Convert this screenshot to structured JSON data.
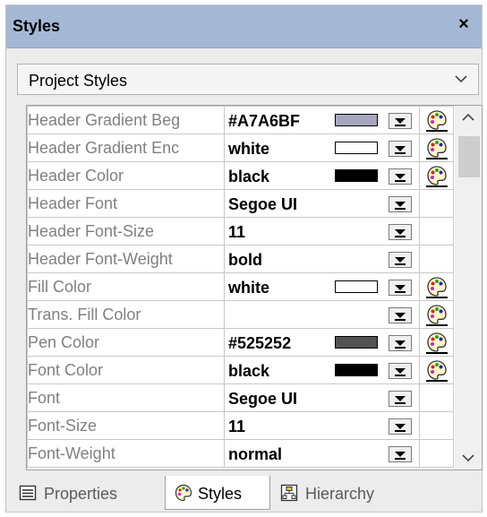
{
  "panel": {
    "title": "Styles",
    "close_label": "×"
  },
  "scope_dropdown": {
    "selected": "Project Styles"
  },
  "rows": [
    {
      "name": "Header Gradient Beg",
      "value": "#A7A6BF",
      "swatch": "#A7A6BF",
      "picker": true
    },
    {
      "name": "Header Gradient Enc",
      "value": "white",
      "swatch": "#ffffff",
      "picker": true
    },
    {
      "name": "Header Color",
      "value": "black",
      "swatch": "#000000",
      "picker": true
    },
    {
      "name": "Header Font",
      "value": "Segoe UI",
      "swatch": null,
      "picker": false
    },
    {
      "name": "Header Font-Size",
      "value": "11",
      "swatch": null,
      "picker": false
    },
    {
      "name": "Header Font-Weight",
      "value": "bold",
      "swatch": null,
      "picker": false
    },
    {
      "name": "Fill Color",
      "value": "white",
      "swatch": "#ffffff",
      "picker": true
    },
    {
      "name": "Trans. Fill Color",
      "value": "",
      "swatch": null,
      "picker": true
    },
    {
      "name": "Pen Color",
      "value": "#525252",
      "swatch": "#525252",
      "picker": true
    },
    {
      "name": "Font Color",
      "value": "black",
      "swatch": "#000000",
      "picker": true
    },
    {
      "name": "Font",
      "value": "Segoe UI",
      "swatch": null,
      "picker": false
    },
    {
      "name": "Font-Size",
      "value": "11",
      "swatch": null,
      "picker": false
    },
    {
      "name": "Font-Weight",
      "value": "normal",
      "swatch": null,
      "picker": false
    }
  ],
  "tabs": [
    {
      "id": "properties",
      "label": "Properties",
      "icon": "properties-icon",
      "active": false
    },
    {
      "id": "styles",
      "label": "Styles",
      "icon": "palette-icon",
      "active": true
    },
    {
      "id": "hierarchy",
      "label": "Hierarchy",
      "icon": "hierarchy-icon",
      "active": false
    }
  ],
  "colors": {
    "titlebar": "#a4b8d5",
    "property_name": "#808080"
  }
}
